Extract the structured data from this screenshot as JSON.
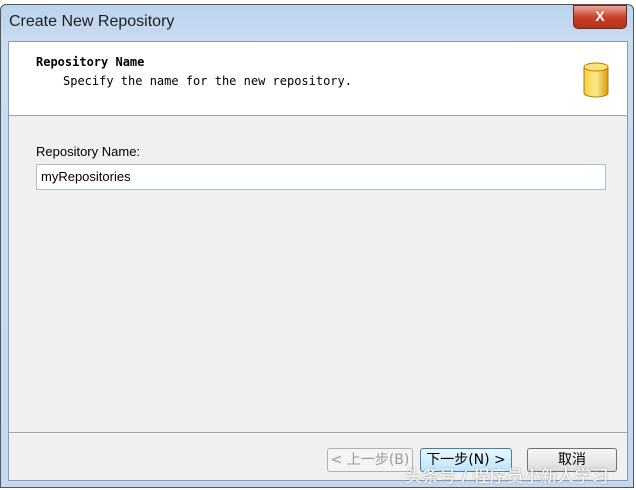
{
  "window": {
    "title": "Create New Repository",
    "close_label": "X"
  },
  "header": {
    "title": "Repository Name",
    "subtitle": "Specify the name for the new repository.",
    "icon": "database-icon"
  },
  "form": {
    "label": "Repository Name:",
    "value": "myRepositories"
  },
  "buttons": {
    "back": "< 上一步(B)",
    "next": "下一步(N) >",
    "cancel": "取消"
  },
  "watermark": "头条号 / 程序员小新人学习"
}
